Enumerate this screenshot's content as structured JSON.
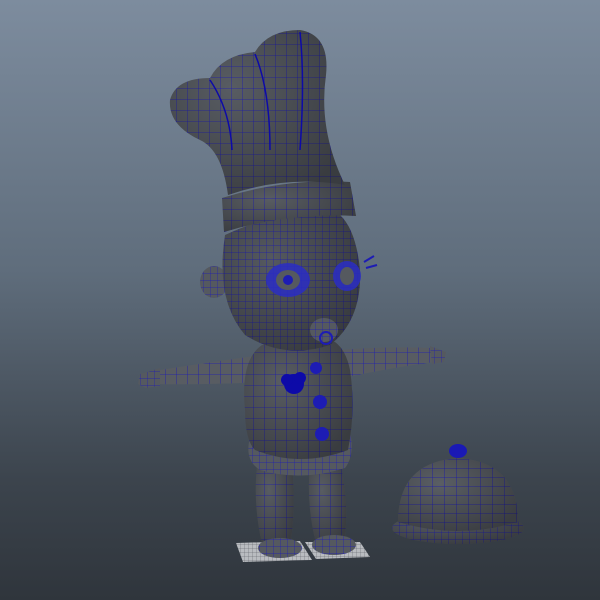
{
  "viewport": {
    "background_top": "#7d8c9e",
    "background_bottom": "#2f353c"
  },
  "scene": {
    "character": "chef-baby",
    "prop": "food-cloche",
    "shade_color": "#565a60",
    "shade_dark": "#3b3e44",
    "wire_color": "#1d1cb4",
    "wire_accent": "#0d0aa8",
    "ground_tile_color": "#bfc2c6"
  }
}
